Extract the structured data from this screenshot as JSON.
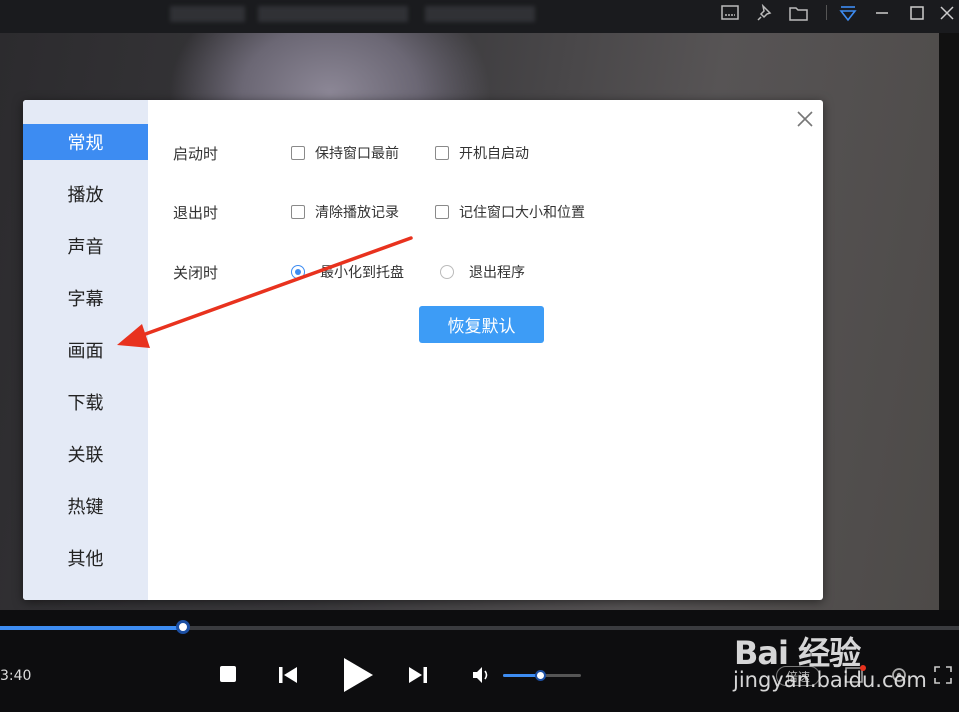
{
  "sidebar": {
    "items": [
      {
        "label": "常规",
        "active": true
      },
      {
        "label": "播放"
      },
      {
        "label": "声音"
      },
      {
        "label": "字幕"
      },
      {
        "label": "画面"
      },
      {
        "label": "下载"
      },
      {
        "label": "关联"
      },
      {
        "label": "热键"
      },
      {
        "label": "其他"
      }
    ]
  },
  "settings": {
    "startup": {
      "label": "启动时",
      "options": [
        {
          "label": "保持窗口最前",
          "checked": false
        },
        {
          "label": "开机自启动",
          "checked": false
        }
      ]
    },
    "exit": {
      "label": "退出时",
      "options": [
        {
          "label": "清除播放记录",
          "checked": false
        },
        {
          "label": "记住窗口大小和位置",
          "checked": false
        }
      ]
    },
    "close": {
      "label": "关闭时",
      "options": [
        {
          "label": "最小化到托盘",
          "selected": true
        },
        {
          "label": "退出程序",
          "selected": false
        }
      ]
    },
    "restore_button": "恢复默认"
  },
  "player": {
    "time": "3:40",
    "progress": 0.19,
    "volume": 0.5,
    "speed_label": "倍速"
  },
  "watermark": {
    "brand": "Bai 经验",
    "site": "jingyan.baidu.com"
  },
  "colors": {
    "accent": "#3d8cf2",
    "sidebar_bg": "#e4eaf6",
    "arrow": "#e8321e"
  }
}
